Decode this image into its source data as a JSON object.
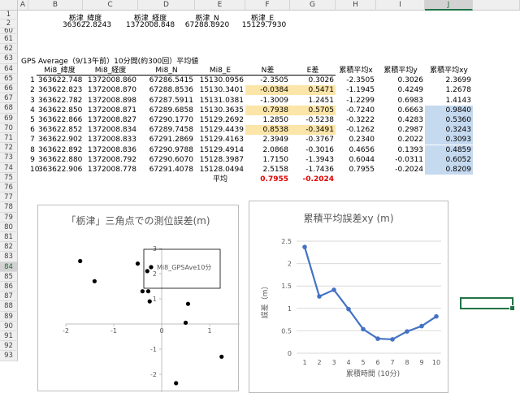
{
  "columns": [
    "A",
    "B",
    "C",
    "D",
    "E",
    "F",
    "G",
    "H",
    "I",
    "J"
  ],
  "selected_column": "J",
  "row_numbers": [
    "1",
    "2",
    "60",
    "61",
    "62",
    "63",
    "64",
    "65",
    "66",
    "67",
    "68",
    "69",
    "70",
    "71",
    "72",
    "73",
    "74",
    "75",
    "76",
    "77",
    "78",
    "79",
    "80",
    "81",
    "82",
    "83",
    "84",
    "85",
    "86",
    "87",
    "88",
    "89",
    "90",
    "91",
    "92",
    "93"
  ],
  "selected_row": "84",
  "header_rows": {
    "row1": [
      "栃津_緯度",
      "栃津_経度",
      "栃津_N",
      "栃津_E"
    ],
    "row2": [
      "363622.8243",
      "1372008.848",
      "67288.8920",
      "15129.7930"
    ]
  },
  "section_title": "GPS  Average（9/13午前）10分間(約300回）平均値",
  "table_headers": [
    "Mi8_緯度",
    "Mi8_経度",
    "Mi8_N",
    "Mi8_E",
    "N差",
    "E差",
    "累積平均x",
    "累積平均y",
    "累積平均xy"
  ],
  "rows": [
    [
      "1",
      "363622.748",
      "1372008.860",
      "67286.5415",
      "15130.0956",
      "-2.3505",
      "0.3026",
      "-2.3505",
      "0.3026",
      "2.3699"
    ],
    [
      "2",
      "363622.823",
      "1372008.870",
      "67288.8536",
      "15130.3401",
      "-0.0384",
      "0.5471",
      "-1.1945",
      "0.4249",
      "1.2678"
    ],
    [
      "3",
      "363622.782",
      "1372008.898",
      "67287.5911",
      "15131.0381",
      "-1.3009",
      "1.2451",
      "-1.2299",
      "0.6983",
      "1.4143"
    ],
    [
      "4",
      "363622.850",
      "1372008.871",
      "67289.6858",
      "15130.3635",
      "0.7938",
      "0.5705",
      "-0.7240",
      "0.6663",
      "0.9840"
    ],
    [
      "5",
      "363622.866",
      "1372008.827",
      "67290.1770",
      "15129.2692",
      "1.2850",
      "-0.5238",
      "-0.3222",
      "0.4283",
      "0.5360"
    ],
    [
      "6",
      "363622.852",
      "1372008.834",
      "67289.7458",
      "15129.4439",
      "0.8538",
      "-0.3491",
      "-0.1262",
      "0.2987",
      "0.3243"
    ],
    [
      "7",
      "363622.902",
      "1372008.833",
      "67291.2869",
      "15129.4163",
      "2.3949",
      "-0.3767",
      "0.2340",
      "0.2022",
      "0.3093"
    ],
    [
      "8",
      "363622.892",
      "1372008.836",
      "67290.9788",
      "15129.4914",
      "2.0868",
      "-0.3016",
      "0.4656",
      "0.1393",
      "0.4859"
    ],
    [
      "9",
      "363622.880",
      "1372008.792",
      "67290.6070",
      "15128.3987",
      "1.7150",
      "-1.3943",
      "0.6044",
      "-0.0311",
      "0.6052"
    ],
    [
      "10",
      "363622.906",
      "1372008.778",
      "67291.4078",
      "15128.0494",
      "2.5158",
      "-1.7436",
      "0.7955",
      "-0.2024",
      "0.8209"
    ]
  ],
  "average_label": "平均",
  "average_values": [
    "0.7955",
    "-0.2024"
  ],
  "colors": {
    "yellow": "#fce5a8",
    "blue": "#c5d9ef",
    "red": "#e00000",
    "line": "#4472c4",
    "selection": "#217346"
  },
  "chart_data": [
    {
      "type": "scatter",
      "title": "「栃津」三角点での測位誤差(m)",
      "annotation": "Mi8_GPSAve10分",
      "xlim": [
        -2,
        2
      ],
      "ylim": [
        -3,
        3
      ],
      "xticks": [
        "-2",
        "-1",
        "0",
        "1",
        "2"
      ],
      "yticks": [
        "3",
        "2",
        "1",
        "0",
        "-1",
        "-2",
        "-3"
      ],
      "series": [
        {
          "x": [
            -1.7,
            -1.4,
            -0.5,
            -0.3,
            -0.25,
            -0.4,
            -0.28,
            0.55,
            0.5,
            1.25,
            0.3
          ],
          "y": [
            2.5,
            1.7,
            2.4,
            2.1,
            0.9,
            1.3,
            1.3,
            0.8,
            0.05,
            -1.3,
            -2.35
          ]
        }
      ]
    },
    {
      "type": "line",
      "title": "累積平均誤差xy (m)",
      "xlabel": "累積時間 (10分)",
      "ylabel": "誤差（m）",
      "ylim": [
        0,
        2.5
      ],
      "yticks": [
        "2.5",
        "2",
        "1.5",
        "1",
        "0.5",
        "0"
      ],
      "categories": [
        "1",
        "2",
        "3",
        "4",
        "5",
        "6",
        "7",
        "8",
        "9",
        "10"
      ],
      "values": [
        2.3699,
        1.2678,
        1.4143,
        0.984,
        0.536,
        0.3243,
        0.3093,
        0.4859,
        0.6052,
        0.8209
      ]
    }
  ]
}
